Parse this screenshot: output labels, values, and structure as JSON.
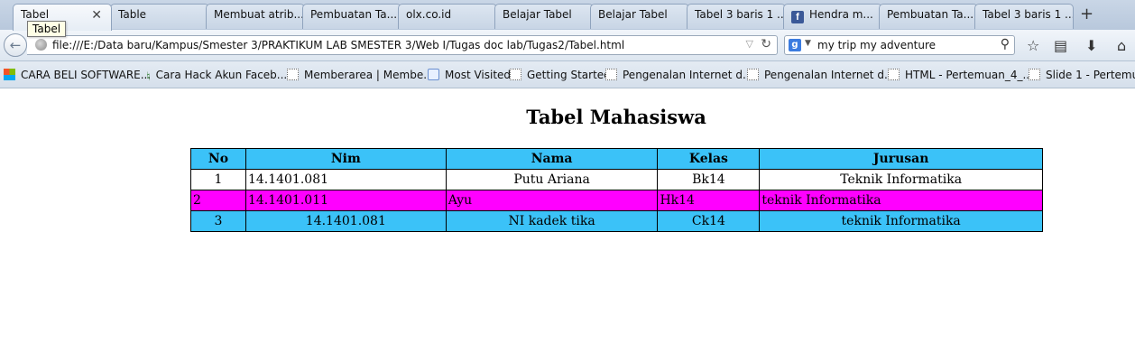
{
  "browser": {
    "tabs": [
      {
        "label": "Tabel",
        "active": true
      },
      {
        "label": "Table"
      },
      {
        "label": "Membuat atrib..."
      },
      {
        "label": "Pembuatan Ta..."
      },
      {
        "label": "olx.co.id"
      },
      {
        "label": "Belajar Tabel"
      },
      {
        "label": "Belajar Tabel"
      },
      {
        "label": "Tabel 3 baris 1 ..."
      },
      {
        "label": "Hendra m...",
        "icon": "facebook-icon"
      },
      {
        "label": "Pembuatan Ta..."
      },
      {
        "label": "Tabel 3 baris 1 ..."
      }
    ],
    "tab_close_symbol": "✕",
    "new_tab_symbol": "+",
    "tooltip": "Tabel",
    "url": "file:///E:/Data baru/Kampus/Smester 3/PRAKTIKUM LAB SMESTER 3/Web I/Tugas doc lab/Tugas2/Tabel.html",
    "search_engine_letter": "g",
    "search_text": "my trip my adventure",
    "bookmarks": [
      {
        "label": "CARA BELI SOFTWARE...",
        "icon": "windows-icon"
      },
      {
        "label": "Cara Hack Akun Faceb...",
        "icon": "runner-icon"
      },
      {
        "label": "Memberarea | Membe...",
        "icon": "page-icon"
      },
      {
        "label": "Most Visited",
        "icon": "star-folder-icon"
      },
      {
        "label": "Getting Started",
        "icon": "page-icon"
      },
      {
        "label": "Pengenalan Internet d...",
        "icon": "page-icon"
      },
      {
        "label": "Pengenalan Internet d...",
        "icon": "page-icon"
      },
      {
        "label": "HTML - Pertemuan_4_...",
        "icon": "page-icon"
      },
      {
        "label": "Slide 1 - Pertemuan",
        "icon": "page-icon"
      }
    ]
  },
  "page": {
    "title": "Tabel Mahasiswa",
    "table": {
      "headers": [
        "No",
        "Nim",
        "Nama",
        "Kelas",
        "Jurusan"
      ],
      "rows": [
        [
          "1",
          "14.1401.081",
          "Putu Ariana",
          "Bk14",
          "Teknik Informatika"
        ],
        [
          "2",
          "14.1401.011",
          "Ayu",
          "Hk14",
          "teknik Informatika"
        ],
        [
          "3",
          "14.1401.081",
          "NI kadek tika",
          "Ck14",
          "teknik Informatika"
        ]
      ]
    },
    "colors": {
      "header": "#3bc2f8",
      "row2": "#ff00ff",
      "row3": "#3bc2f8"
    }
  }
}
